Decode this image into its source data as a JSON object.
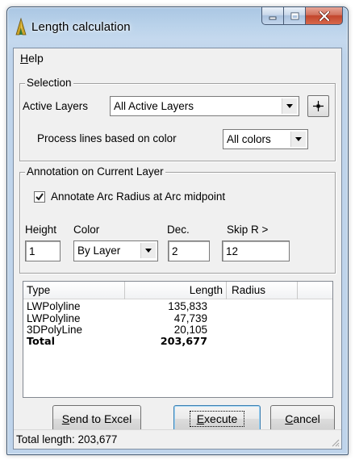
{
  "window": {
    "title": "Length calculation",
    "icon": "autocad-logo-icon",
    "controls": [
      "minimize-icon",
      "maximize-icon",
      "close-icon"
    ]
  },
  "menu": {
    "help_accel": "H",
    "help_rest": "elp"
  },
  "selection": {
    "legend": "Selection",
    "active_layers_label": "Active Layers",
    "active_layers_value": "All Active Layers",
    "pick_icon": "crosshair-icon",
    "color_label": "Process lines based on color",
    "color_value": "All colors"
  },
  "annotation": {
    "legend": "Annotation on Current Layer",
    "checkbox_label": "Annotate Arc Radius at Arc midpoint",
    "checkbox_checked": true,
    "height_label": "Height",
    "color_label": "Color",
    "dec_label": "Dec.",
    "skip_label": "Skip R >",
    "height_value": "1",
    "color_value": "By Layer",
    "dec_value": "2",
    "skip_value": "12"
  },
  "table": {
    "columns": [
      "Type",
      "Length",
      "Radius"
    ],
    "rows": [
      {
        "type": "LWPolyline",
        "length": "135,833",
        "radius": ""
      },
      {
        "type": "LWPolyline",
        "length": "47,739",
        "radius": ""
      },
      {
        "type": "3DPolyLine",
        "length": "20,105",
        "radius": ""
      }
    ],
    "total": {
      "type": "Total",
      "length": "203,677"
    }
  },
  "buttons": {
    "send_accel": "S",
    "send_rest": "end to Excel",
    "execute_accel": "E",
    "execute_rest": "xecute",
    "cancel_accel": "C",
    "cancel_rest": "ancel"
  },
  "status": {
    "text": "Total length: 203,677"
  },
  "colors": {
    "titlebar": "#b9d2ea",
    "close_button": "#c2452c",
    "dialog_bg": "#f0f0f0",
    "default_button_border": "#3c7fb1"
  }
}
